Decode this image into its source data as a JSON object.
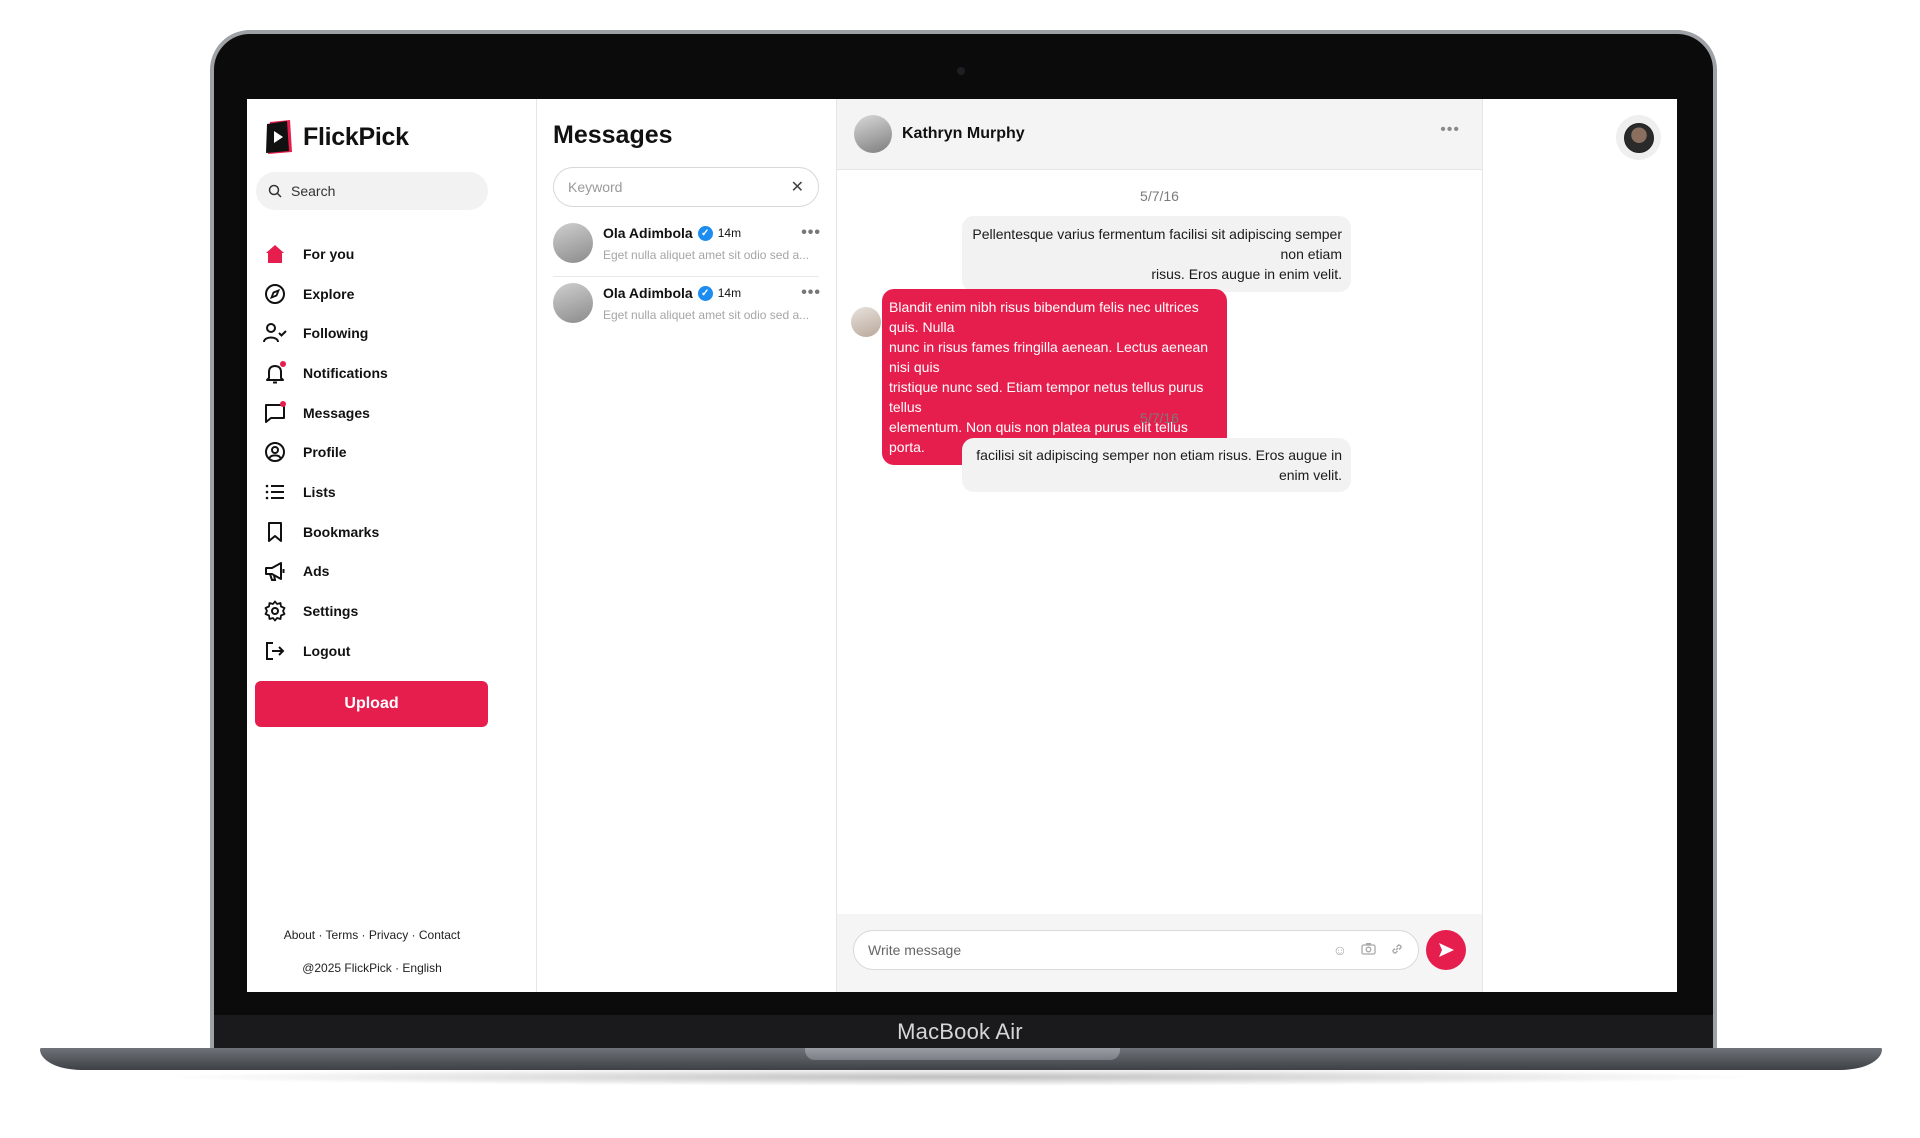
{
  "device": {
    "label": "MacBook Air"
  },
  "app": {
    "name": "FlickPick",
    "accent": "#e61e4d"
  },
  "sidebar": {
    "search_label": "Search",
    "items": [
      {
        "label": "For you",
        "icon": "home-icon",
        "active": true
      },
      {
        "label": "Explore",
        "icon": "compass-icon"
      },
      {
        "label": "Following",
        "icon": "user-check-icon"
      },
      {
        "label": "Notifications",
        "icon": "bell-icon",
        "dot": true
      },
      {
        "label": "Messages",
        "icon": "message-square-icon",
        "dot": true
      },
      {
        "label": "Profile",
        "icon": "user-circle-icon"
      },
      {
        "label": "Lists",
        "icon": "list-icon"
      },
      {
        "label": "Bookmarks",
        "icon": "bookmark-icon"
      },
      {
        "label": "Ads",
        "icon": "megaphone-icon"
      },
      {
        "label": "Settings",
        "icon": "gear-icon"
      },
      {
        "label": "Logout",
        "icon": "logout-icon"
      }
    ],
    "upload_label": "Upload",
    "footer_links": "About · Terms · Privacy · Contact",
    "footer_copy": "@2025 FlickPick · English"
  },
  "messages": {
    "title": "Messages",
    "keyword_placeholder": "Keyword",
    "conversations": [
      {
        "name": "Ola Adimbola",
        "time": "14m",
        "preview": "Eget nulla aliquet amet sit odio sed a..."
      },
      {
        "name": "Ola Adimbola",
        "time": "14m",
        "preview": "Eget nulla aliquet amet sit odio sed a..."
      }
    ]
  },
  "chat": {
    "contact_name": "Kathryn Murphy",
    "date_1": "5/7/16",
    "msg_1_line_1": "Pellentesque varius fermentum facilisi sit adipiscing semper non etiam",
    "msg_1_line_2": "risus. Eros augue in enim velit.",
    "msg_2_line_1": "Blandit enim nibh risus bibendum felis nec ultrices quis. Nulla",
    "msg_2_line_2": "nunc in risus fames fringilla aenean. Lectus aenean nisi quis",
    "msg_2_line_3": "tristique nunc sed. Etiam tempor netus tellus purus tellus",
    "msg_2_line_4": "elementum. Non quis non platea purus elit tellus porta.",
    "date_2": "5/7/16",
    "msg_3": "facilisi sit adipiscing semper non etiam risus. Eros augue in enim velit.",
    "composer_placeholder": "Write message"
  }
}
